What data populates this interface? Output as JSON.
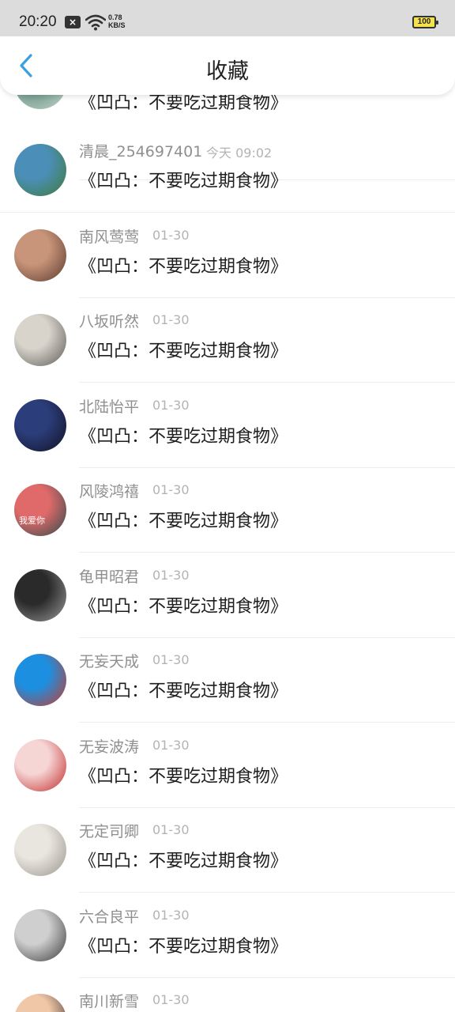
{
  "status_bar": {
    "time": "20:20",
    "net_speed_value": "0.78",
    "net_speed_unit": "KB/S",
    "battery": "100"
  },
  "header": {
    "title": "收藏",
    "back_icon": "chevron-left-icon",
    "accent_color": "#3aa0e0"
  },
  "items": [
    {
      "name": "",
      "time": "",
      "title": "《凹凸：不要吃过期食物》",
      "avatar_colors": [
        "#6f9a8a",
        "#c9d6cf"
      ]
    },
    {
      "name": "清晨_254697401",
      "time": "今天 09:02",
      "title": "《凹凸：不要吃过期食物》",
      "avatar_colors": [
        "#4b8fb8",
        "#3f7a3a"
      ]
    },
    {
      "name": "南风莺莺",
      "time": "01-30",
      "title": "《凹凸：不要吃过期食物》",
      "avatar_colors": [
        "#c9957a",
        "#5a3a2e"
      ]
    },
    {
      "name": "八坂听然",
      "time": "01-30",
      "title": "《凹凸：不要吃过期食物》",
      "avatar_colors": [
        "#d8d4cc",
        "#5d5a55"
      ]
    },
    {
      "name": "北陆怡平",
      "time": "01-30",
      "title": "《凹凸：不要吃过期食物》",
      "avatar_colors": [
        "#2b3d7a",
        "#111122"
      ]
    },
    {
      "name": "风陵鸿禧",
      "time": "01-30",
      "title": "《凹凸：不要吃过期食物》",
      "avatar_colors": [
        "#e06a6a",
        "#2e4a4a"
      ],
      "avatar_text": "我爱你"
    },
    {
      "name": "龟甲昭君",
      "time": "01-30",
      "title": "《凹凸：不要吃过期食物》",
      "avatar_colors": [
        "#2a2a2a",
        "#9a9a9a"
      ]
    },
    {
      "name": "无妄天成",
      "time": "01-30",
      "title": "《凹凸：不要吃过期食物》",
      "avatar_colors": [
        "#1d8fe0",
        "#c83a2a"
      ]
    },
    {
      "name": "无妄波涛",
      "time": "01-30",
      "title": "《凹凸：不要吃过期食物》",
      "avatar_colors": [
        "#f6d5d5",
        "#c22a2a"
      ]
    },
    {
      "name": "无定司卿",
      "time": "01-30",
      "title": "《凹凸：不要吃过期食物》",
      "avatar_colors": [
        "#e9e6e0",
        "#9a958c"
      ]
    },
    {
      "name": "六合良平",
      "time": "01-30",
      "title": "《凹凸：不要吃过期食物》",
      "avatar_colors": [
        "#cfcfcf",
        "#3a3a3a"
      ]
    },
    {
      "name": "南川新雪",
      "time": "01-30",
      "title": "",
      "avatar_colors": [
        "#f0c8a8",
        "#3a2a2a"
      ]
    }
  ]
}
